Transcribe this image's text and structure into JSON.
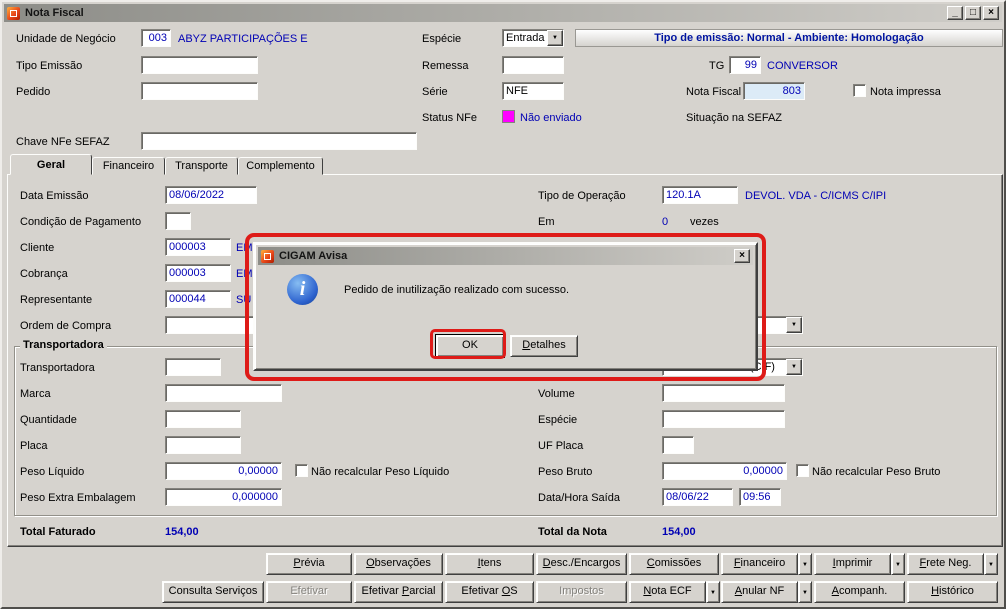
{
  "icons": {
    "dropdown": "▼",
    "info": "i",
    "minimize": "_",
    "maximize": "□",
    "close": "×"
  },
  "colors": {
    "window_bg": "#d6d3ce",
    "value_blue": "#0000b4",
    "banner_blue": "#0014a0",
    "status_magenta": "#ff00ff",
    "annotation_red": "#de1b18",
    "nota_fiscal_field_bg": "#dcebf7"
  },
  "window": {
    "title": "Nota Fiscal"
  },
  "banner": {
    "text": "Tipo de emissão: Normal - Ambiente: Homologação"
  },
  "header": {
    "unidade_label": "Unidade de Negócio",
    "unidade_value": "003",
    "unidade_desc": "ABYZ PARTICIPAÇÕES E",
    "especie_label": "Espécie",
    "especie_value": "Entrada",
    "tipo_emissao_label": "Tipo Emissão",
    "tipo_emissao_value": "",
    "remessa_label": "Remessa",
    "remessa_value": "",
    "tg_label": "TG",
    "tg_value": "99",
    "tg_desc": "CONVERSOR",
    "pedido_label": "Pedido",
    "pedido_value": "",
    "serie_label": "Série",
    "serie_value": "NFE",
    "nota_fiscal_label": "Nota Fiscal",
    "nota_fiscal_value": "803",
    "nota_impressa_label": "Nota impressa",
    "nota_impressa_checked": false,
    "status_nfe_label": "Status NFe",
    "status_nfe_value": "Não enviado",
    "situacao_sefaz_label": "Situação na SEFAZ",
    "chave_label": "Chave NFe SEFAZ",
    "chave_value": ""
  },
  "tabs": [
    {
      "label": "Geral",
      "active": true
    },
    {
      "label": "Financeiro",
      "active": false
    },
    {
      "label": "Transporte",
      "active": false
    },
    {
      "label": "Complemento",
      "active": false
    }
  ],
  "geral": {
    "data_emissao_label": "Data Emissão",
    "data_emissao_value": "08/06/2022",
    "tipo_operacao_label": "Tipo de Operação",
    "tipo_operacao_value": "120.1A",
    "tipo_operacao_desc": "DEVOL. VDA - C/ICMS C/IPI",
    "condicao_label": "Condição de Pagamento",
    "condicao_value": "",
    "em_label": "Em",
    "em_value": "0",
    "em_suffix": "vezes",
    "cliente_label": "Cliente",
    "cliente_value": "000003",
    "cliente_desc": "EM",
    "cobranca_label": "Cobrança",
    "cobranca_value": "000003",
    "cobranca_desc": "EM",
    "representante_label": "Representante",
    "representante_value": "000044",
    "representante_desc": "SU",
    "ordem_label": "Ordem de Compra",
    "ordem_value": "",
    "right_combo_value": ""
  },
  "transp": {
    "group_label": "Transportadora",
    "transportadora_label": "Transportadora",
    "transportadora_value": "",
    "frete_value": "CONTRATANTE (CIF)",
    "marca_label": "Marca",
    "marca_value": "",
    "volume_label": "Volume",
    "volume_value": "",
    "quantidade_label": "Quantidade",
    "quantidade_value": "",
    "especie_label": "Espécie",
    "especie_value": "",
    "placa_label": "Placa",
    "placa_value": "",
    "uf_label": "UF Placa",
    "uf_value": "",
    "peso_liquido_label": "Peso Líquido",
    "peso_liquido_value": "0,00000",
    "peso_liquido_chk": "Não recalcular Peso Líquido",
    "peso_bruto_label": "Peso Bruto",
    "peso_bruto_value": "0,00000",
    "peso_bruto_chk": "Não recalcular Peso Bruto",
    "peso_extra_label": "Peso Extra Embalagem",
    "peso_extra_value": "0,000000",
    "saida_label": "Data/Hora Saída",
    "saida_date": "08/06/22",
    "saida_time": "09:56"
  },
  "totals": {
    "faturado_label": "Total Faturado",
    "faturado_value": "154,00",
    "nota_label": "Total da Nota",
    "nota_value": "154,00"
  },
  "dialog": {
    "title": "CIGAM Avisa",
    "message": "Pedido de inutilização realizado com sucesso.",
    "ok": {
      "pre": "OK",
      "u": "",
      "post": ""
    },
    "detalhes": {
      "pre": "",
      "u": "D",
      "post": "etalhes"
    }
  },
  "row1": [
    {
      "pre": "",
      "u": "P",
      "post": "révia"
    },
    {
      "pre": "",
      "u": "O",
      "post": "bservações"
    },
    {
      "pre": "",
      "u": "I",
      "post": "tens"
    },
    {
      "pre": "",
      "u": "D",
      "post": "esc./Encargos"
    },
    {
      "pre": "",
      "u": "C",
      "post": "omissões"
    },
    {
      "pre": "",
      "u": "F",
      "post": "inanceiro",
      "has_dropdown": true
    },
    {
      "pre": "",
      "u": "I",
      "post": "mprimir",
      "has_dropdown": true
    },
    {
      "pre": "",
      "u": "F",
      "post": "rete Neg.",
      "has_dropdown": true
    }
  ],
  "row2": [
    {
      "pre": "Consulta Serviços",
      "u": "",
      "post": ""
    },
    {
      "pre": "Efetivar",
      "u": "",
      "post": "",
      "disabled": true
    },
    {
      "pre": "Efetivar ",
      "u": "P",
      "post": "arcial"
    },
    {
      "pre": "Efetivar ",
      "u": "O",
      "post": "S"
    },
    {
      "pre": "Impostos",
      "u": "",
      "post": "",
      "disabled": true
    },
    {
      "pre": "",
      "u": "N",
      "post": "ota ECF",
      "has_dropdown": true
    },
    {
      "pre": "",
      "u": "A",
      "post": "nular NF",
      "has_dropdown": true
    },
    {
      "pre": "",
      "u": "A",
      "post": "companh."
    },
    {
      "pre": "",
      "u": "H",
      "post": "istórico"
    }
  ]
}
